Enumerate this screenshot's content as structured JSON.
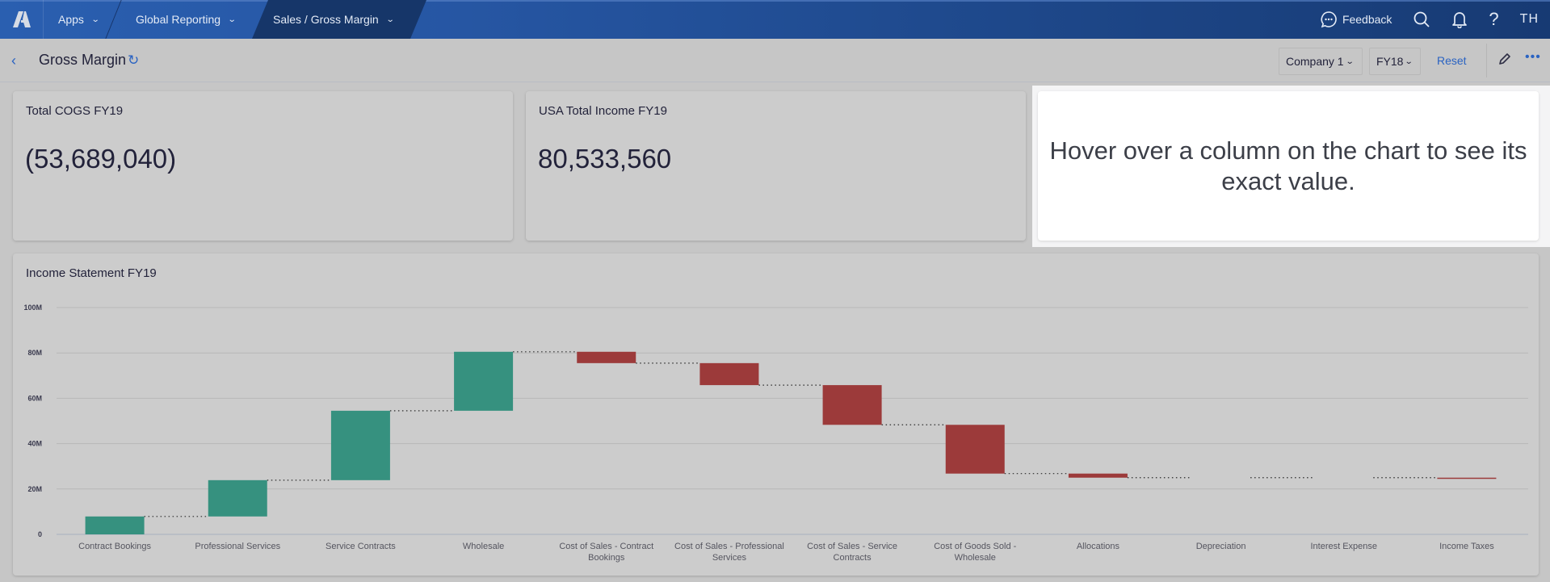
{
  "topnav": {
    "logo": "anaplan-logo",
    "items": [
      {
        "label": "Apps"
      },
      {
        "label": "Global Reporting"
      },
      {
        "label": "Sales / Gross Margin",
        "active": true
      }
    ],
    "feedback_label": "Feedback",
    "avatar_initials": "TH",
    "colors": {
      "bar": "#2656a3",
      "active": "#163669"
    }
  },
  "subheader": {
    "title": "Gross Margin",
    "company_select": "Company 1",
    "year_select": "FY18",
    "reset_label": "Reset"
  },
  "kpis": [
    {
      "label": "Total COGS FY19",
      "value": "(53,689,040)"
    },
    {
      "label": "USA Total Income FY19",
      "value": "80,533,560"
    }
  ],
  "hover_hint": "Hover over a column on the chart to see its exact value.",
  "chart_data": {
    "type": "waterfall",
    "title": "Income Statement FY19",
    "xlabel": "",
    "ylabel": "",
    "ylim": [
      0,
      100000000
    ],
    "yticks": [
      0,
      20000000,
      40000000,
      60000000,
      80000000,
      100000000
    ],
    "ytick_labels": [
      "0",
      "20M",
      "40M",
      "60M",
      "80M",
      "100M"
    ],
    "grid": true,
    "colors": {
      "increase": "#36917f",
      "decrease": "#9c3a3a"
    },
    "categories": [
      [
        "Contract Bookings"
      ],
      [
        "Professional Services"
      ],
      [
        "Service Contracts"
      ],
      [
        "Wholesale"
      ],
      [
        "Cost of Sales - Contract",
        "Bookings"
      ],
      [
        "Cost of Sales - Professional",
        "Services"
      ],
      [
        "Cost of Sales - Service",
        "Contracts"
      ],
      [
        "Cost of Goods Sold -",
        "Wholesale"
      ],
      [
        "Allocations"
      ],
      [
        "Depreciation"
      ],
      [
        "Interest Expense"
      ],
      [
        "Income Taxes"
      ]
    ],
    "values": [
      7900000,
      16000000,
      30600000,
      26000000,
      -5000000,
      -9700000,
      -17500000,
      -21500000,
      -1800000,
      0,
      0,
      -200000
    ]
  }
}
